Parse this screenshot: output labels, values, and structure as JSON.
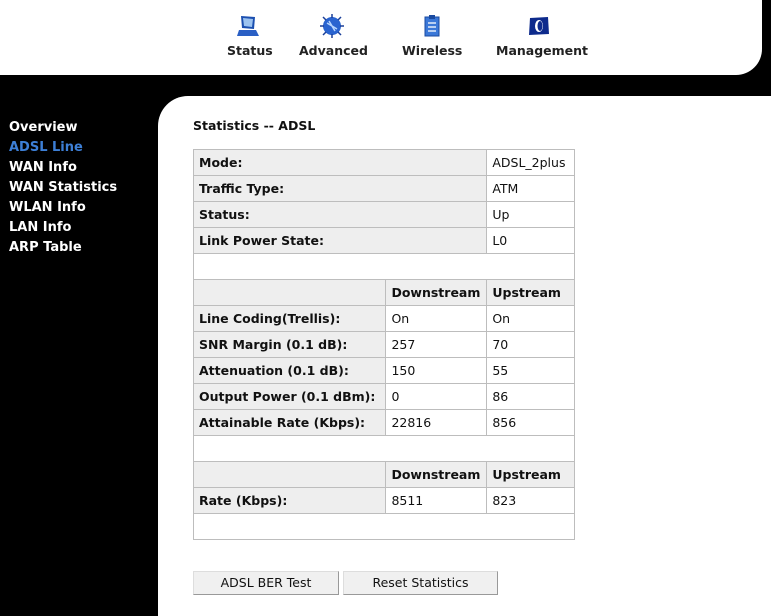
{
  "top_nav": [
    {
      "label": "Status",
      "icon": "laptop-icon"
    },
    {
      "label": "Advanced",
      "icon": "chip-icon"
    },
    {
      "label": "Wireless",
      "icon": "clipboard-icon"
    },
    {
      "label": "Management",
      "icon": "folder-icon"
    }
  ],
  "sidebar": {
    "items": [
      {
        "label": "Overview",
        "active": false
      },
      {
        "label": "ADSL Line",
        "active": true
      },
      {
        "label": "WAN Info",
        "active": false
      },
      {
        "label": "WAN Statistics",
        "active": false
      },
      {
        "label": "WLAN Info",
        "active": false
      },
      {
        "label": "LAN Info",
        "active": false
      },
      {
        "label": "ARP Table",
        "active": false
      }
    ],
    "active_color": "#3d7fd6"
  },
  "page": {
    "title": "Statistics -- ADSL"
  },
  "summary": [
    {
      "label": "Mode:",
      "value": "ADSL_2plus"
    },
    {
      "label": "Traffic Type:",
      "value": "ATM"
    },
    {
      "label": "Status:",
      "value": "Up"
    },
    {
      "label": "Link Power State:",
      "value": "L0"
    }
  ],
  "line_stats": {
    "headers": [
      "Downstream",
      "Upstream"
    ],
    "rows": [
      {
        "label": "Line Coding(Trellis):",
        "down": "On",
        "up": "On"
      },
      {
        "label": "SNR Margin (0.1 dB):",
        "down": "257",
        "up": "70"
      },
      {
        "label": "Attenuation (0.1 dB):",
        "down": "150",
        "up": "55"
      },
      {
        "label": "Output Power (0.1 dBm):",
        "down": "0",
        "up": "86"
      },
      {
        "label": "Attainable Rate (Kbps):",
        "down": "22816",
        "up": "856"
      }
    ]
  },
  "rate_stats": {
    "headers": [
      "Downstream",
      "Upstream"
    ],
    "rows": [
      {
        "label": "Rate (Kbps):",
        "down": "8511",
        "up": "823"
      }
    ]
  },
  "buttons": {
    "ber_test": "ADSL BER Test",
    "reset": "Reset Statistics"
  }
}
